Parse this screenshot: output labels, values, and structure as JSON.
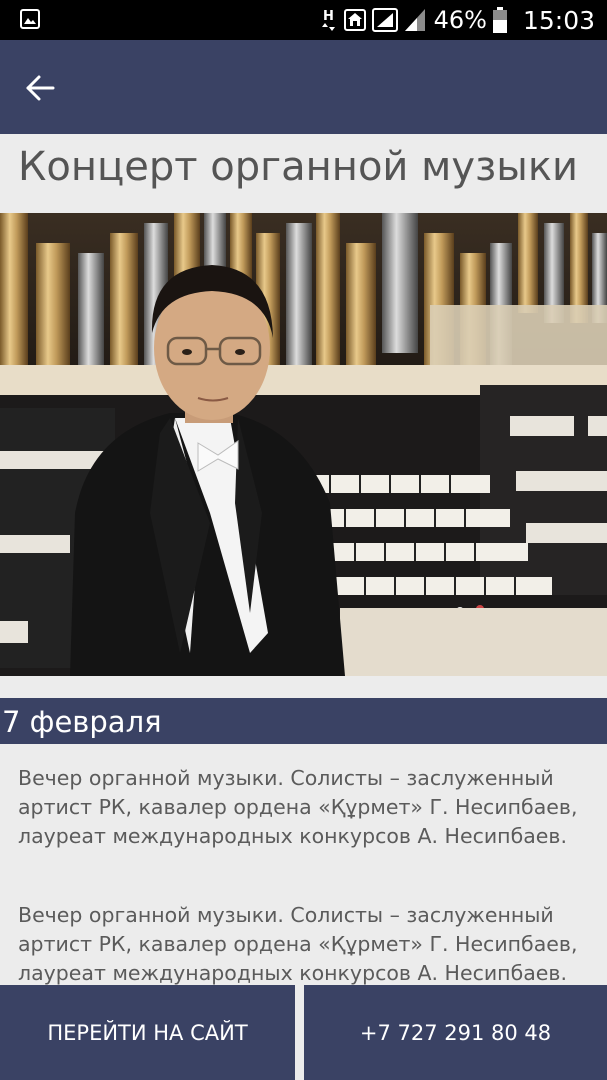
{
  "status_bar": {
    "battery_percent": "46%",
    "time": "15:03",
    "network_label": "H",
    "icons": [
      "image-icon",
      "network-h-icon",
      "home-icon",
      "signal-icon",
      "signal-icon-2",
      "battery-icon"
    ]
  },
  "app_bar": {
    "back_icon": "arrow-left-icon",
    "color": "#3a4264"
  },
  "event": {
    "title": "Концерт органной музыки",
    "date": "7 февраля",
    "description_1": "Вечер органной музыки. Солисты – заслуженный артист РК, кавалер ордена «Құрмет» Г. Несипбаев, лауреат международных конкурсов А. Несипбаев.",
    "description_2": "Вечер органной музыки. Солисты – заслуженный артист РК, кавалер ордена «Құрмет» Г. Несипбаев, лауреат международных конкурсов А. Несипбаев."
  },
  "actions": {
    "site_label": "ПЕРЕЙТИ НА САЙТ",
    "phone_label": "+7 727 291 80 48"
  }
}
